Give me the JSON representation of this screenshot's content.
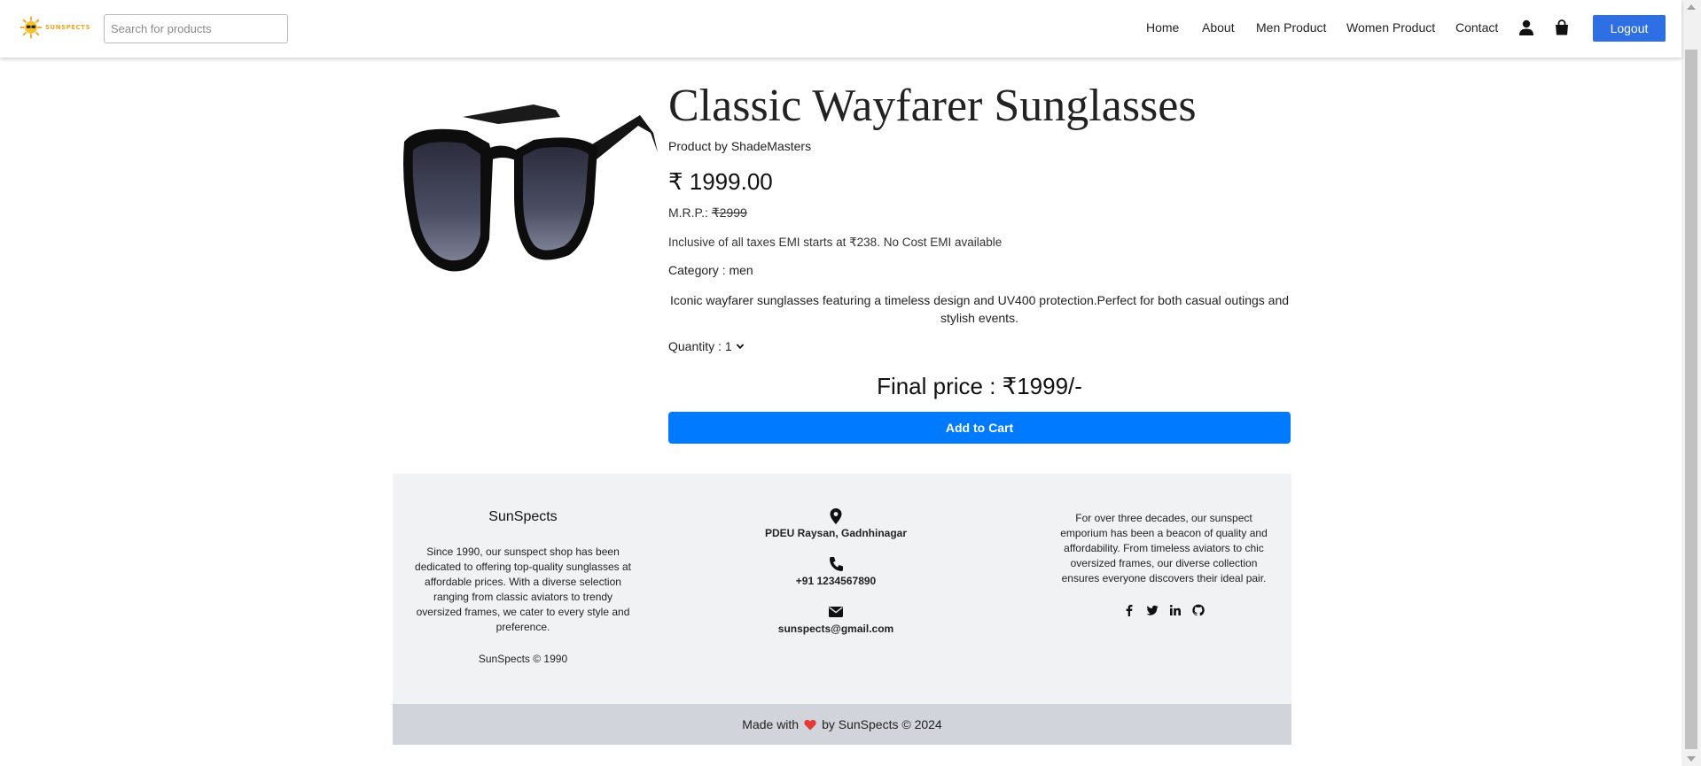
{
  "navbar": {
    "logo_text": "SUNSPECTS",
    "search_placeholder": "Search for products",
    "links": [
      "Home",
      "About",
      "Men Product",
      "Women Product",
      "Contact"
    ],
    "icons": [
      "user-icon",
      "shopping-bag-icon"
    ],
    "logout_label": "Logout"
  },
  "product": {
    "title": "Classic Wayfarer Sunglasses",
    "brand": "Product by ShadeMasters",
    "price": "₹ 1999.00",
    "mrp_label": "M.R.P.:",
    "mrp_value": "₹2999",
    "tax_note": "Inclusive of all taxes EMI starts at ₹238. No Cost EMI available",
    "category": "Category : men",
    "description": "Iconic wayfarer sunglasses featuring a timeless design and UV400 protection.Perfect for both casual outings and stylish events.",
    "quantity_label": "Quantity :",
    "quantity_value": "1",
    "final_price": "Final price : ₹1999/-",
    "add_to_cart_label": "Add to Cart"
  },
  "footer": {
    "brand": "SunSpects",
    "about": "Since 1990, our sunspect shop has been dedicated to offering top-quality sunglasses at affordable prices. With a diverse selection ranging from classic aviators to trendy oversized frames, we cater to every style and preference.",
    "copyright": "SunSpects © 1990",
    "address": "PDEU Raysan, Gadnhinagar",
    "phone": "+91 1234567890",
    "email": "sunspects@gmail.com",
    "history": "For over three decades, our sunspect emporium has been a beacon of quality and affordability. From timeless aviators to chic oversized frames, our diverse collection ensures everyone discovers their ideal pair.",
    "social_icons": [
      "facebook-icon",
      "twitter-icon",
      "linkedin-icon",
      "github-icon"
    ],
    "bottom_prefix": "Made with",
    "bottom_suffix": "by SunSpects © 2024"
  },
  "colors": {
    "primary_button": "#007bff",
    "logout_button": "#2f6fe4",
    "footer_bg": "#f1f2f4",
    "footer_bottom_bg": "#d1d5db",
    "heart": "#e53935",
    "logo_accent": "#f5a623"
  }
}
